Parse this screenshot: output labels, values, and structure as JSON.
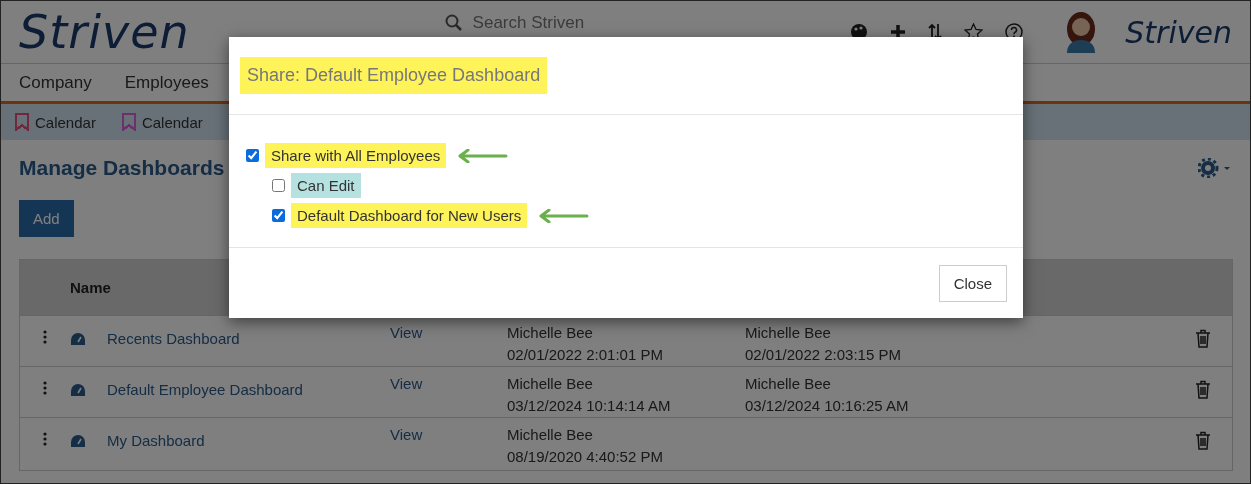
{
  "header": {
    "logo": "Striven",
    "search": {
      "placeholder": "Search Striven"
    },
    "brand": "Striven"
  },
  "nav": [
    "Company",
    "Employees"
  ],
  "bookmarks": [
    {
      "label": "Calendar",
      "color": "#70283d"
    },
    {
      "label": "Calendar",
      "color": "#6c306c"
    }
  ],
  "page": {
    "title": "Manage Dashboards",
    "add_button": "Add"
  },
  "table": {
    "columns": [
      "Name"
    ],
    "rows": [
      {
        "name": "Recents Dashboard",
        "view": "View",
        "created_by": "Michelle Bee",
        "created_at": "02/01/2022 2:01:01 PM",
        "modified_by": "Michelle Bee",
        "modified_at": "02/01/2022 2:03:15 PM"
      },
      {
        "name": "Default Employee Dashboard",
        "view": "View",
        "created_by": "Michelle Bee",
        "created_at": "03/12/2024 10:14:14 AM",
        "modified_by": "Michelle Bee",
        "modified_at": "03/12/2024 10:16:25 AM"
      },
      {
        "name": "My Dashboard",
        "view": "View",
        "created_by": "Michelle Bee",
        "created_at": "08/19/2020 4:40:52 PM"
      }
    ]
  },
  "dialog": {
    "title": "Share: Default Employee Dashboard",
    "options": [
      {
        "label": "Share with All Employees",
        "checked": true,
        "color": "#fff35a",
        "arrow": true,
        "children": [
          {
            "label": "Can Edit",
            "checked": false,
            "color": "#b5e2e0",
            "arrow": false
          },
          {
            "label": "Default Dashboard for New Users",
            "checked": true,
            "color": "#fff35a",
            "arrow": true
          }
        ]
      }
    ],
    "close_button": "Close"
  }
}
